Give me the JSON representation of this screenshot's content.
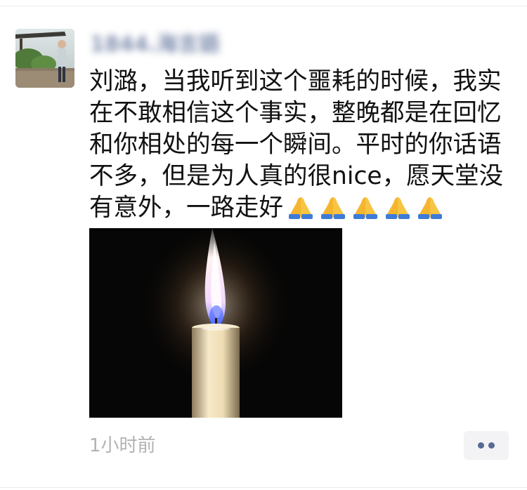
{
  "post": {
    "author_name": "1844.海言語",
    "text": "刘潞，当我听到这个噩耗的时候，我实\n在不敢相信这个事实，整晚都是在回忆\n和你相处的每一个瞬间。平时的你话语\n不多，但是为人真的很nice，愿天堂没\n有意外，一路走好",
    "emoji": [
      "folded-hands",
      "folded-hands",
      "folded-hands",
      "folded-hands",
      "folded-hands"
    ],
    "image_subject": "candle-flame",
    "timestamp": "1小时前"
  },
  "colors": {
    "name": "#576b95",
    "timestamp": "#b2b2b2",
    "text": "#111111",
    "more_button_bg": "#f3f3f5"
  }
}
